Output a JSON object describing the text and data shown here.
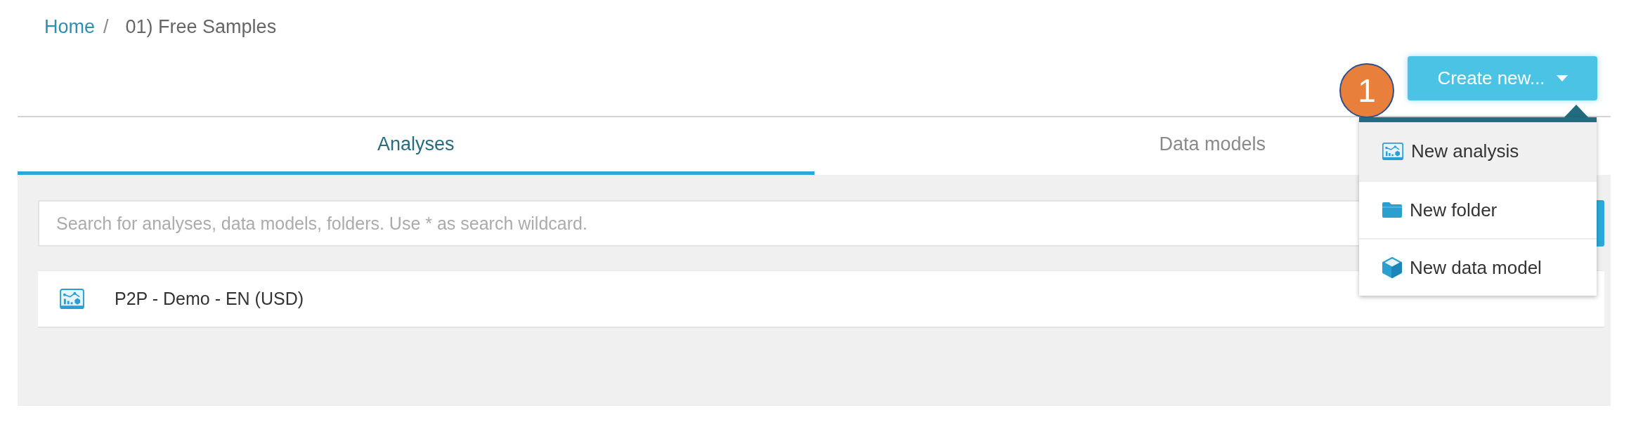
{
  "breadcrumb": {
    "items": [
      {
        "label": "Home",
        "kind": "link"
      },
      {
        "label": "01) Free Samples",
        "kind": "current"
      }
    ],
    "separator": "/"
  },
  "create_button": {
    "label": "Create new..."
  },
  "step_badge": {
    "label": "1"
  },
  "create_menu": {
    "items": [
      {
        "label": "New analysis",
        "kind": "analysis",
        "highlighted": true
      },
      {
        "label": "New folder",
        "kind": "folder",
        "highlighted": false
      },
      {
        "label": "New data model",
        "kind": "data_model",
        "highlighted": false
      }
    ]
  },
  "tabs": [
    {
      "label": "Analyses",
      "selected": true
    },
    {
      "label": "Data models",
      "selected": false
    }
  ],
  "search": {
    "placeholder": "Search for analyses, data models, folders. Use * as search wildcard."
  },
  "items": [
    {
      "name": "P2P - Demo - EN (USD)",
      "kind": "analysis"
    }
  ]
}
